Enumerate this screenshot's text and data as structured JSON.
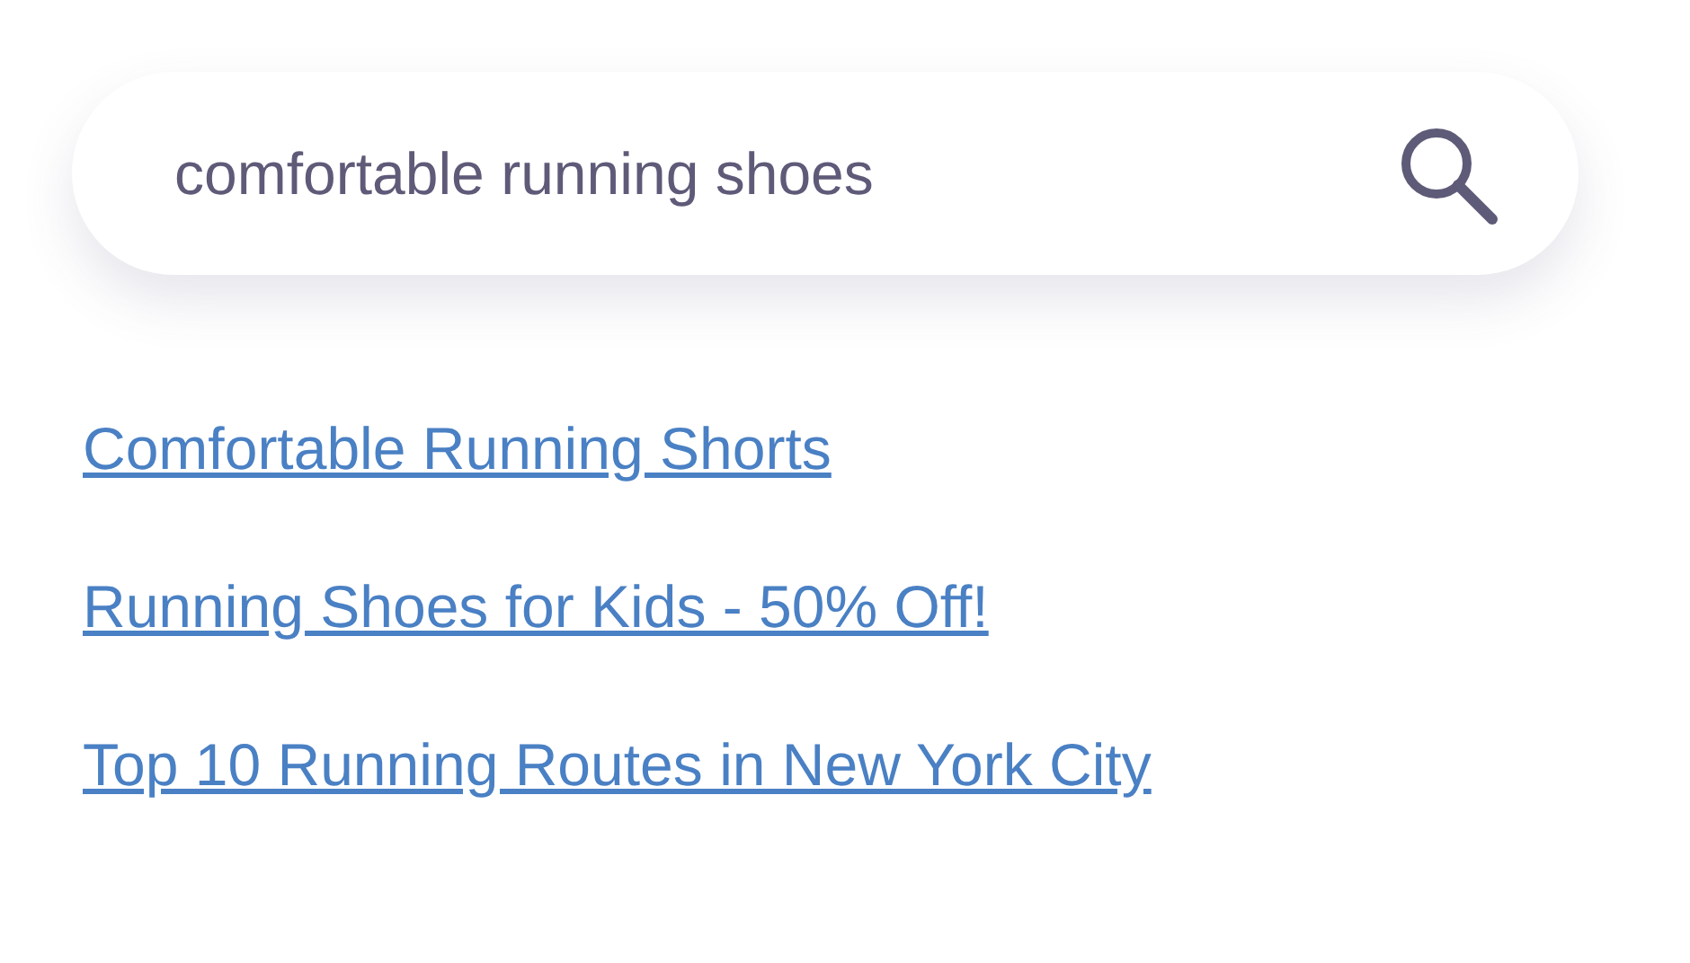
{
  "search": {
    "value": "comfortable running shoes"
  },
  "suggestions": [
    {
      "label": "Comfortable Running Shorts"
    },
    {
      "label": "Running Shoes for Kids - 50% Off!"
    },
    {
      "label": "Top 10 Running Routes in New York City"
    }
  ]
}
